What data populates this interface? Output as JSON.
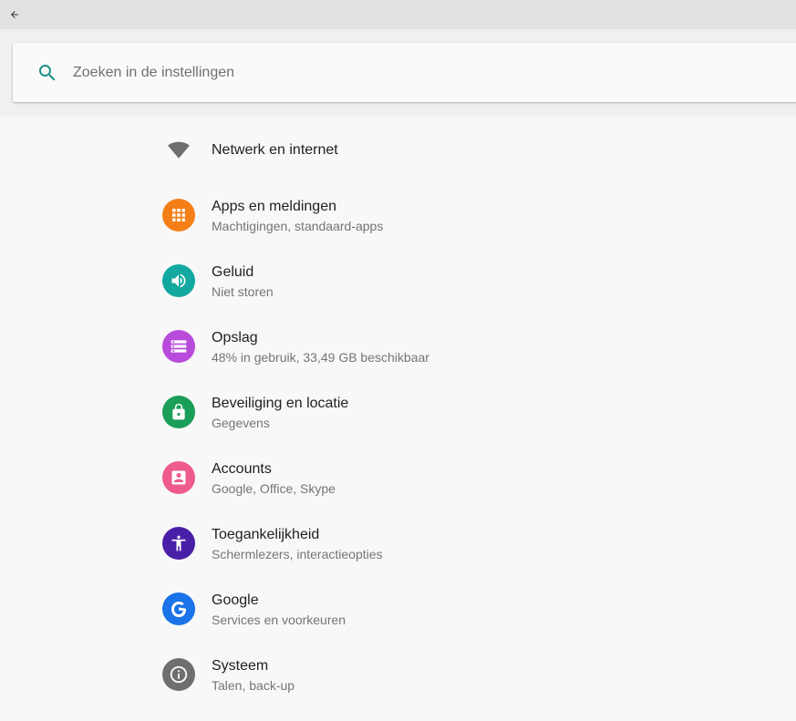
{
  "topbar": {
    "back_icon": "arrow-back-icon"
  },
  "search": {
    "placeholder": "Zoeken in de instellingen",
    "value": "",
    "icon": "search-icon",
    "icon_color": "#1a8f8b"
  },
  "settings": {
    "items": [
      {
        "title": "Netwerk en internet",
        "subtitle": "",
        "icon": "wifi-icon",
        "color": "#6f6f6f"
      },
      {
        "title": "Apps en meldingen",
        "subtitle": "Machtigingen, standaard-apps",
        "icon": "apps-grid-icon",
        "color": "#f57f17"
      },
      {
        "title": "Geluid",
        "subtitle": "Niet storen",
        "icon": "volume-icon",
        "color": "#13a8a0"
      },
      {
        "title": "Opslag",
        "subtitle": "48% in gebruik, 33,49 GB beschikbaar",
        "icon": "storage-icon",
        "color": "#b84bdb"
      },
      {
        "title": "Beveiliging en locatie",
        "subtitle": "Gegevens",
        "icon": "lock-icon",
        "color": "#1b9e58"
      },
      {
        "title": "Accounts",
        "subtitle": "Google, Office, Skype",
        "icon": "account-icon",
        "color": "#ee5b8e"
      },
      {
        "title": "Toegankelijkheid",
        "subtitle": "Schermlezers, interactieopties",
        "icon": "accessibility-icon",
        "color": "#4a1fa8"
      },
      {
        "title": "Google",
        "subtitle": "Services en voorkeuren",
        "icon": "google-icon",
        "color": "#1a73e8"
      },
      {
        "title": "Systeem",
        "subtitle": "Talen, back-up",
        "icon": "info-icon",
        "color": "#6f6f6f"
      }
    ]
  }
}
